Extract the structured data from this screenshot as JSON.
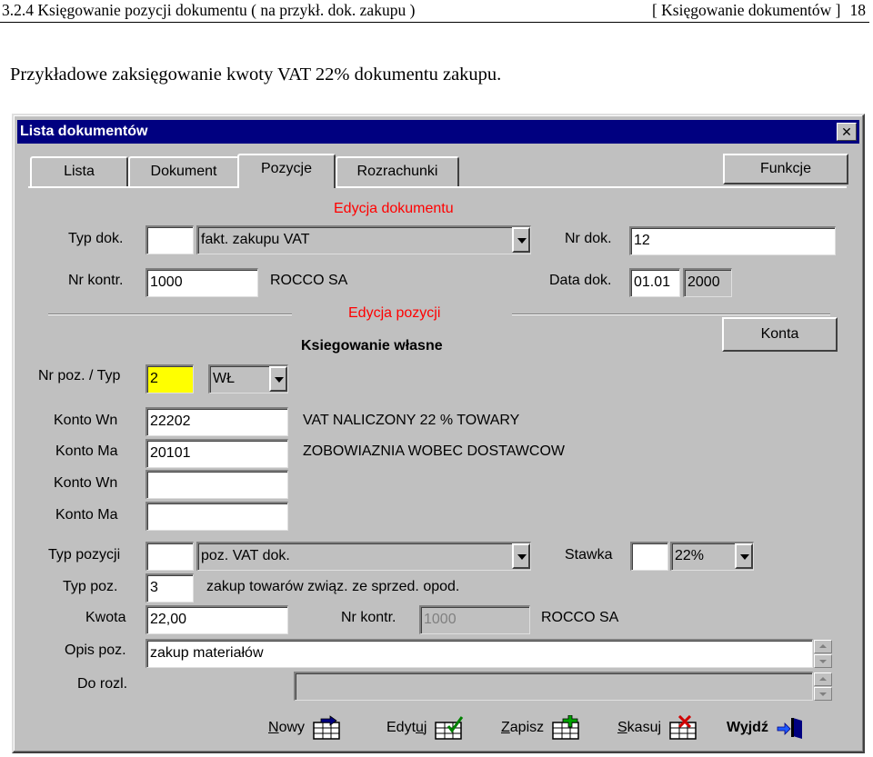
{
  "doc": {
    "header_left": "3.2.4 Księgowanie pozycji dokumentu ( na przykł. dok. zakupu )",
    "header_right": "[ Księgowanie dokumentów ]",
    "page_number": "18",
    "intro": "Przykładowe zaksięgowanie kwoty VAT 22% dokumentu zakupu."
  },
  "window": {
    "title": "Lista dokumentów",
    "close": "✕"
  },
  "tabs": [
    {
      "label": "Lista",
      "active": false
    },
    {
      "label": "Dokument",
      "active": false
    },
    {
      "label": "Pozycje",
      "active": true
    },
    {
      "label": "Rozrachunki",
      "active": false
    }
  ],
  "buttons": {
    "funkcje": "Funkcje",
    "konta": "Konta"
  },
  "sections": {
    "edycja_dokumentu": "Edycja dokumentu",
    "edycja_pozycji": "Edycja pozycji",
    "ksiegowanie_wlasne": "Ksiegowanie własne"
  },
  "dokument": {
    "typ_dok_label": "Typ dok.",
    "typ_dok_code": "",
    "typ_dok_value": "fakt. zakupu VAT",
    "nr_dok_label": "Nr dok.",
    "nr_dok_value": "12",
    "nr_kontr_label": "Nr kontr.",
    "nr_kontr_value": "1000",
    "kontrahent_name": "ROCCO SA",
    "data_dok_label": "Data dok.",
    "data_dok_day": "01.01",
    "data_dok_year": "2000"
  },
  "pozycja": {
    "nr_poz_label": "Nr poz. / Typ",
    "nr_poz_value": "2",
    "typ_value": "WŁ",
    "konto_wn_label": "Konto Wn",
    "konto_wn_value": "22202",
    "konto_wn_desc": "VAT NALICZONY 22 % TOWARY",
    "konto_ma_label": "Konto Ma",
    "konto_ma_value": "20101",
    "konto_ma_desc": "ZOBOWIAZNIA WOBEC DOSTAWCOW",
    "konto_wn2_label": "Konto Wn",
    "konto_wn2_value": "",
    "konto_ma2_label": "Konto Ma",
    "konto_ma2_value": "",
    "typ_pozycji_label": "Typ pozycji",
    "typ_pozycji_code": "",
    "typ_pozycji_value": "poz. VAT dok.",
    "stawka_label": "Stawka",
    "stawka_code": "",
    "stawka_value": "22%",
    "typ_poz_label": "Typ poz.",
    "typ_poz_value": "3",
    "typ_poz_desc": "zakup towarów związ. ze sprzed. opod.",
    "kwota_label": "Kwota",
    "kwota_value": "22,00",
    "nr_kontr2_label": "Nr kontr.",
    "nr_kontr2_value": "1000",
    "kontrahent2_name": "ROCCO SA",
    "opis_label": "Opis poz.",
    "opis_value": "zakup materiałów",
    "do_rozl_label": "Do rozl.",
    "do_rozl_value": ""
  },
  "toolbar": {
    "nowy": {
      "pre": "",
      "ul": "N",
      "post": "owy"
    },
    "edytuj": {
      "pre": "Edyt",
      "ul": "u",
      "post": "j"
    },
    "zapisz": {
      "pre": "",
      "ul": "Z",
      "post": "apisz"
    },
    "skasuj": {
      "pre": "",
      "ul": "S",
      "post": "kasuj"
    },
    "wyjdz": {
      "pre": "W",
      "ul": "y",
      "post": "jdź"
    }
  },
  "colors": {
    "title_bar": "#000080",
    "window_bg": "#c0c0c0",
    "section_label": "#ff0000",
    "highlight_field": "#ffff00"
  }
}
